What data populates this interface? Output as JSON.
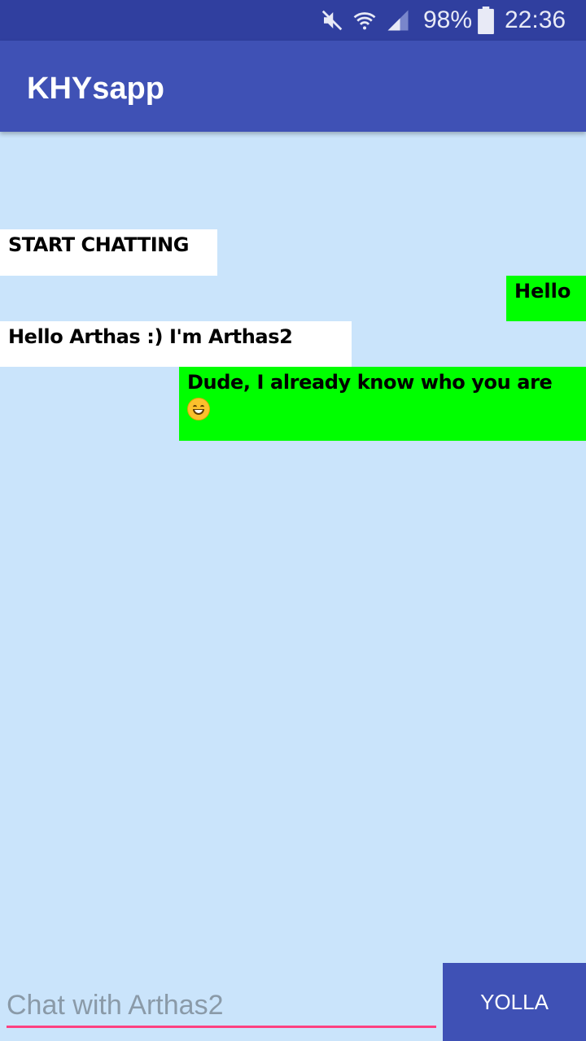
{
  "status_bar": {
    "battery_percent": "98%",
    "time": "22:36",
    "icons": [
      "mute-icon",
      "wifi-icon",
      "signal-icon",
      "battery-icon"
    ]
  },
  "app_bar": {
    "title": "KHYsapp"
  },
  "messages": [
    {
      "text": "START CHATTING",
      "side": "incoming",
      "bubble_color": "#ffffff"
    },
    {
      "text": "Hello",
      "side": "outgoing",
      "bubble_color": "#00ff00"
    },
    {
      "text": "Hello Arthas :) I'm Arthas2",
      "side": "incoming",
      "bubble_color": "#ffffff"
    },
    {
      "text": "Dude, I already know who you are",
      "emoji": "grinning-face-with-blush-icon",
      "side": "outgoing",
      "bubble_color": "#00ff00"
    }
  ],
  "composer": {
    "placeholder": "Chat with Arthas2",
    "value": "",
    "send_label": "YOLLA"
  },
  "colors": {
    "status_bar": "#303f9f",
    "primary": "#3f51b5",
    "background": "#cae4fb",
    "accent": "#ff4081"
  }
}
